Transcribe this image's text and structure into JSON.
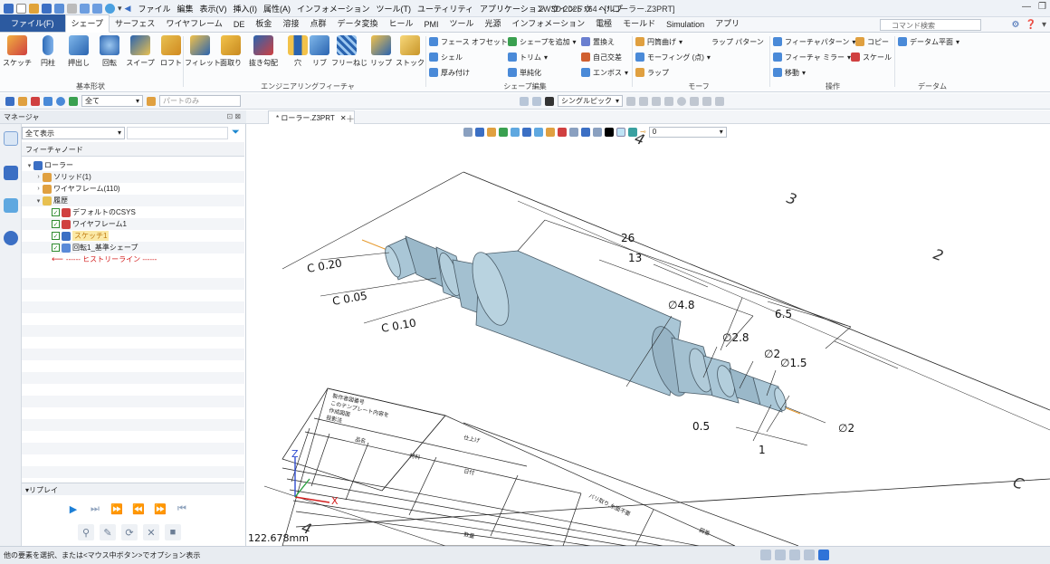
{
  "window": {
    "title": "ZW3D 2025 x64 - [* ローラー.Z3PRT]",
    "menu": [
      "ファイル",
      "編集",
      "表示(V)",
      "挿入(I)",
      "属性(A)",
      "インフォメーション",
      "ツール(T)",
      "ユーティリティ",
      "アプリケーション",
      "ウインドウ",
      "ヘルプ"
    ]
  },
  "ribbon_tabs": {
    "file": "ファイル(F)",
    "items": [
      "シェープ",
      "サーフェス",
      "ワイヤフレーム",
      "DE",
      "板金",
      "溶接",
      "点群",
      "データ変換",
      "ヒール",
      "PMI",
      "ツール",
      "光源",
      "インフォメーション",
      "電極",
      "モールド",
      "Simulation",
      "アプリ"
    ],
    "active": "シェープ",
    "search_placeholder": "コマンド検索"
  },
  "ribbon": {
    "basic": {
      "label": "基本形状",
      "buttons": [
        "スケッチ",
        "円柱",
        "押出し",
        "回転",
        "スイープ",
        "ロフト"
      ]
    },
    "engineering": {
      "label": "エンジニアリングフィーチャ",
      "buttons": [
        "フィレット",
        "面取り",
        "抜き勾配",
        "穴",
        "リブ",
        "フリーねじ",
        "リップ",
        "ストック"
      ]
    },
    "shape_edit": {
      "label": "シェープ編集",
      "items": [
        "フェース オフセット",
        "シェープを追加",
        "置換え",
        "シェル",
        "トリム",
        "自己交差",
        "厚み付け",
        "単純化",
        "エンボス"
      ]
    },
    "morph": {
      "label": "モーフ",
      "items": [
        "円筒曲げ",
        "ラップ パターン",
        "モーフィング (点)",
        "ラップ"
      ]
    },
    "operation": {
      "label": "操作",
      "items": [
        "フィーチャパターン",
        "コピー",
        "フィーチャ ミラー",
        "スケール",
        "移動"
      ]
    },
    "datum": {
      "label": "データム",
      "items": [
        "データム平面"
      ]
    }
  },
  "toolbar": {
    "filter_value": "全て",
    "part_label": "パートのみ",
    "pick_mode": "シングルピック"
  },
  "manager": {
    "title": "マネージャ",
    "filter": "全て表示",
    "column": "フィーチャノード",
    "tree": [
      {
        "label": "ローラー",
        "level": 0,
        "twisty": "▾",
        "check": false
      },
      {
        "label": "ソリッド(1)",
        "level": 1,
        "twisty": "›",
        "check": false
      },
      {
        "label": "ワイヤフレーム(110)",
        "level": 1,
        "twisty": "›",
        "check": false
      },
      {
        "label": "履歴",
        "level": 1,
        "twisty": "▾",
        "check": false
      },
      {
        "label": "デフォルトのCSYS",
        "level": 2,
        "twisty": "",
        "check": true
      },
      {
        "label": "ワイヤフレーム1",
        "level": 2,
        "twisty": "",
        "check": true
      },
      {
        "label": "スケッチ1",
        "level": 2,
        "twisty": "",
        "check": true
      },
      {
        "label": "回転1_基準シェープ",
        "level": 2,
        "twisty": "",
        "check": true
      },
      {
        "label": "------ ヒストリーライン ------",
        "level": 2,
        "twisty": "",
        "check": false
      }
    ],
    "replay": "▾リプレイ"
  },
  "document": {
    "tab": "* ローラー.Z3PRT",
    "view_value": "0",
    "scale": "122.678mm"
  },
  "drawing": {
    "dims": {
      "len26": "26",
      "len13": "13",
      "len65": "6.5",
      "len05": "0.5",
      "len1": "1",
      "dia48": "∅4.8",
      "dia28": "∅2.8",
      "dia2a": "∅2",
      "dia15": "∅1.5",
      "dia2b": "∅2",
      "c020": "C 0.20",
      "c005": "C 0.05",
      "c010": "C 0.10"
    },
    "sheet": {
      "num2": "2",
      "num3": "3",
      "num4a": "4",
      "num4b": "4",
      "letterC": "C",
      "sheet_note1": "製作者図番号",
      "sheet_note2": "このテンプレート内容を",
      "sheet_note3": "作成図面",
      "sheet_note4": "投影法",
      "sheet_note5": "仕上げ",
      "sheet_note6": "品名",
      "sheet_note7": "材料",
      "sheet_note8": "日付",
      "sheet_note9": "バリ取り,糸面不要",
      "sheet_note10": "図番",
      "sheet_note11": "数量"
    },
    "axis": {
      "z": "Z",
      "x": "X"
    }
  },
  "status": {
    "text": "他の要素を選択、または<マウス中ボタン>でオプション表示"
  },
  "colors": {
    "part": "#a9c6d6",
    "part_dark": "#8fb0c2",
    "accent": "#2c5aa0",
    "axis_line": "#e69a2e",
    "history_line": "#d32020"
  }
}
